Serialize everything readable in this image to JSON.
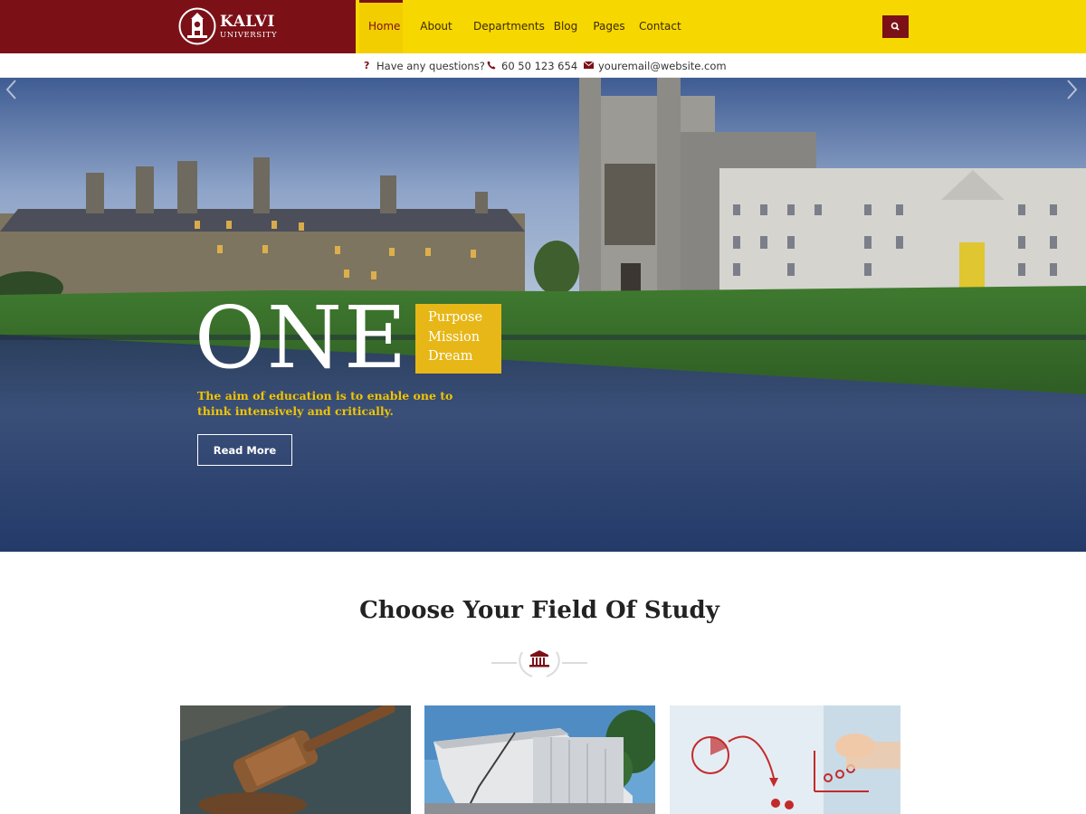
{
  "brand": {
    "name": "KALVI",
    "subtitle": "UNIVERSITY",
    "colors": {
      "primary": "#7b1117",
      "accent": "#f7d700"
    }
  },
  "nav": {
    "items": [
      {
        "label": "Home",
        "active": true
      },
      {
        "label": "About Us",
        "active": false
      },
      {
        "label": "Departments",
        "active": false
      },
      {
        "label": "Blog",
        "active": false
      },
      {
        "label": "Pages",
        "active": false
      },
      {
        "label": "Contact",
        "active": false
      }
    ],
    "search_icon": "search-icon"
  },
  "topbar": {
    "question_icon": "?",
    "question_text": "Have any questions?",
    "phone_icon": "phone-icon",
    "phone": "60 50 123 654",
    "email_icon": "envelope-icon",
    "email": "youremail@website.com"
  },
  "hero": {
    "headline": "ONE",
    "box_lines": [
      "Purpose",
      "Mission",
      "Dream"
    ],
    "tagline": "The aim of education is to enable one to think intensively and critically.",
    "button_label": "Read More",
    "prev_icon": "chevron-left-icon",
    "next_icon": "chevron-right-icon"
  },
  "section": {
    "title": "Choose Your Field Of Study",
    "divider_icon": "institution-icon",
    "cards": [
      {
        "image": "gavel-photo"
      },
      {
        "image": "modern-building-photo"
      },
      {
        "image": "chart-drawing-photo"
      }
    ]
  }
}
